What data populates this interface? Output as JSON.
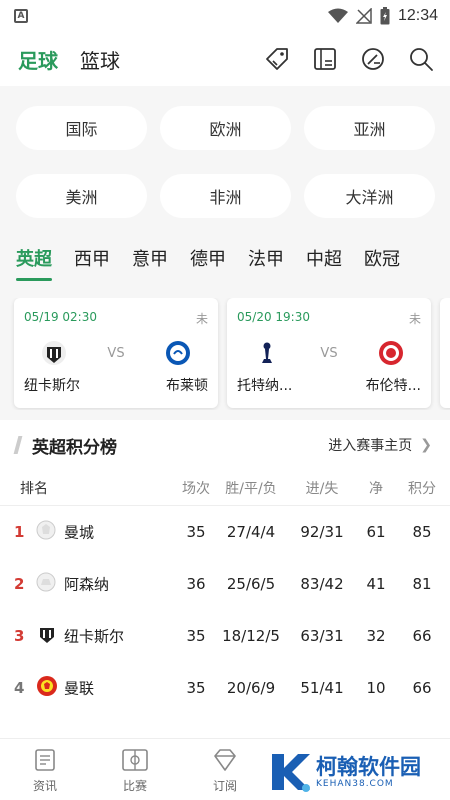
{
  "status_bar": {
    "time": "12:34",
    "app_letter": "A"
  },
  "header": {
    "tabs": [
      "足球",
      "篮球"
    ],
    "active_tab": 0
  },
  "regions": [
    "国际",
    "欧洲",
    "亚洲",
    "美洲",
    "非洲",
    "大洋洲"
  ],
  "leagues": [
    "英超",
    "西甲",
    "意甲",
    "德甲",
    "法甲",
    "中超",
    "欧冠"
  ],
  "matches": [
    {
      "time": "05/19 02:30",
      "status": "未",
      "vs": "VS",
      "home": "纽卡斯尔",
      "away": "布莱顿"
    },
    {
      "time": "05/20 19:30",
      "status": "未",
      "vs": "VS",
      "home": "托特纳...",
      "away": "布伦特..."
    }
  ],
  "standings": {
    "title": "英超积分榜",
    "link": "进入赛事主页",
    "columns": {
      "rank": "排名",
      "played": "场次",
      "wdl": "胜/平/负",
      "goals": "进/失",
      "diff": "净",
      "points": "积分"
    },
    "rows": [
      {
        "rank": "1",
        "team": "曼城",
        "played": "35",
        "wdl": "27/4/4",
        "goals": "92/31",
        "diff": "61",
        "points": "85"
      },
      {
        "rank": "2",
        "team": "阿森纳",
        "played": "36",
        "wdl": "25/6/5",
        "goals": "83/42",
        "diff": "41",
        "points": "81"
      },
      {
        "rank": "3",
        "team": "纽卡斯尔",
        "played": "35",
        "wdl": "18/12/5",
        "goals": "63/31",
        "diff": "32",
        "points": "66"
      },
      {
        "rank": "4",
        "team": "曼联",
        "played": "35",
        "wdl": "20/6/9",
        "goals": "51/41",
        "diff": "10",
        "points": "66"
      }
    ]
  },
  "bottom_nav": [
    "资讯",
    "比赛",
    "订阅"
  ],
  "watermark": {
    "cn": "柯翰软件园",
    "en": "KEHAN38.COM"
  },
  "colors": {
    "accent": "#2a9a5c",
    "rank_top": "#d33b34",
    "watermark": "#1a5fb4"
  }
}
